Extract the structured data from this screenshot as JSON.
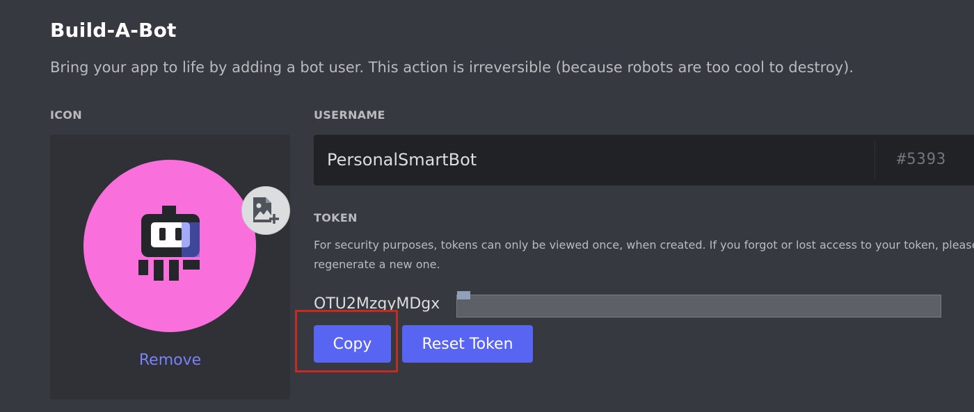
{
  "section": {
    "title": "Build-A-Bot",
    "description": "Bring your app to life by adding a bot user. This action is irreversible (because robots are too cool to destroy)."
  },
  "icon": {
    "label": "ICON",
    "avatar_color": "#f96fdc",
    "avatar_glyph": "robot-icon",
    "upload_glyph": "image-add-icon",
    "remove_label": "Remove"
  },
  "username": {
    "label": "USERNAME",
    "value": "PersonalSmartBot",
    "discriminator": "#5393"
  },
  "token": {
    "label": "TOKEN",
    "help": "For security purposes, tokens can only be viewed once, when created. If you forgot or lost access to your token, please regenerate a new one.",
    "visible_prefix": "OTU2MzgyMDgx",
    "copy_label": "Copy",
    "reset_label": "Reset Token"
  },
  "colors": {
    "background": "#36393f",
    "card": "#2f3136",
    "input": "#202225",
    "accent": "#5865f2",
    "link": "#7983f5",
    "highlight": "#c72a1e"
  }
}
